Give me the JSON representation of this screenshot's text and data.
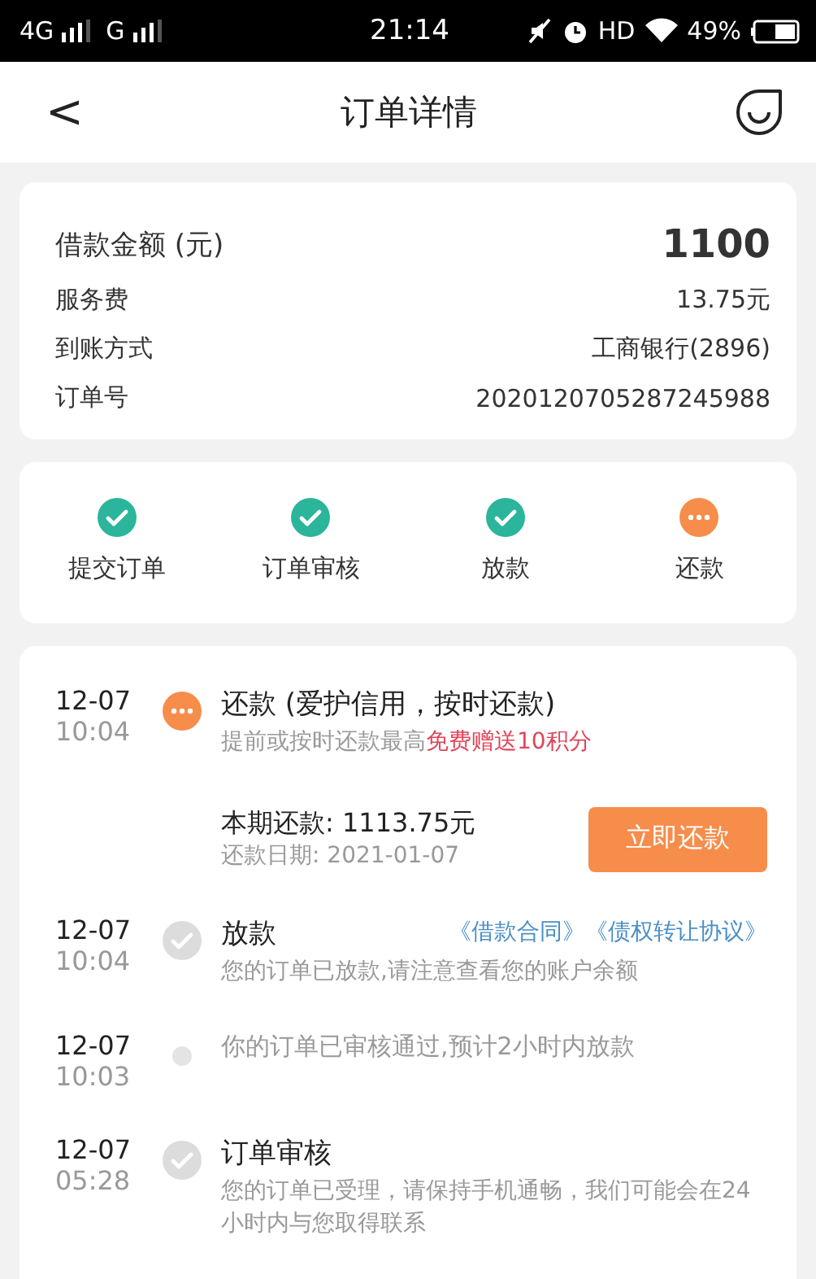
{
  "status_bar": {
    "carrier_1": "4G",
    "carrier_2": "G",
    "time": "21:14",
    "hd": "HD",
    "battery": "49%"
  },
  "header": {
    "back": "<",
    "title": "订单详情"
  },
  "summary": {
    "amount_label": "借款金额 (元)",
    "amount": "1100",
    "rows": [
      {
        "label": "服务费",
        "value": "13.75元"
      },
      {
        "label": "到账方式",
        "value": "工商银行(2896)"
      },
      {
        "label": "订单号",
        "value": "2020120705287245988"
      }
    ]
  },
  "steps": [
    {
      "label": "提交订单",
      "kind": "done"
    },
    {
      "label": "订单审核",
      "kind": "done"
    },
    {
      "label": "放款",
      "kind": "done"
    },
    {
      "label": "还款",
      "kind": "pending"
    }
  ],
  "timeline": [
    {
      "kind": "pending",
      "date": "12-07",
      "time": "10:04",
      "title": "还款 (爱护信用，按时还款)",
      "desc": "提前或按时还款最高",
      "highlight": "免费赠送10积分",
      "payment": {
        "amount": "本期还款: 1113.75元",
        "due": "还款日期: 2021-01-07",
        "button": "立即还款"
      }
    },
    {
      "kind": "done",
      "date": "12-07",
      "time": "10:04",
      "title": "放款",
      "links": [
        "《借款合同》",
        "《债权转让协议》"
      ],
      "desc": "您的订单已放款,请注意查看您的账户余额"
    },
    {
      "kind": "dot",
      "date": "12-07",
      "time": "10:03",
      "desc": "你的订单已审核通过,预计2小时内放款"
    },
    {
      "kind": "done",
      "date": "12-07",
      "time": "05:28",
      "title": "订单审核",
      "desc": "您的订单已受理，请保持手机通畅，我们可能会在24小时内与您取得联系"
    }
  ]
}
